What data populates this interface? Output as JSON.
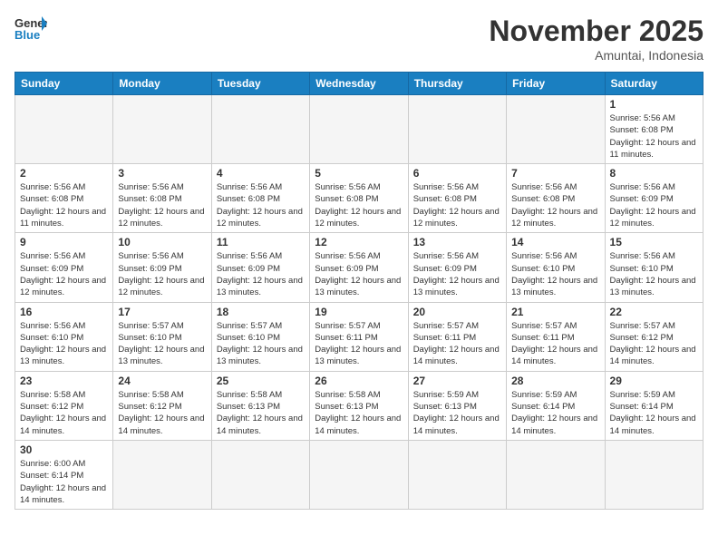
{
  "header": {
    "logo_general": "General",
    "logo_blue": "Blue",
    "month_title": "November 2025",
    "location": "Amuntai, Indonesia"
  },
  "weekdays": [
    "Sunday",
    "Monday",
    "Tuesday",
    "Wednesday",
    "Thursday",
    "Friday",
    "Saturday"
  ],
  "weeks": [
    [
      {
        "day": "",
        "empty": true
      },
      {
        "day": "",
        "empty": true
      },
      {
        "day": "",
        "empty": true
      },
      {
        "day": "",
        "empty": true
      },
      {
        "day": "",
        "empty": true
      },
      {
        "day": "",
        "empty": true
      },
      {
        "day": "1",
        "sunrise": "Sunrise: 5:56 AM",
        "sunset": "Sunset: 6:08 PM",
        "daylight": "Daylight: 12 hours and 11 minutes."
      }
    ],
    [
      {
        "day": "2",
        "sunrise": "Sunrise: 5:56 AM",
        "sunset": "Sunset: 6:08 PM",
        "daylight": "Daylight: 12 hours and 11 minutes."
      },
      {
        "day": "3",
        "sunrise": "Sunrise: 5:56 AM",
        "sunset": "Sunset: 6:08 PM",
        "daylight": "Daylight: 12 hours and 12 minutes."
      },
      {
        "day": "4",
        "sunrise": "Sunrise: 5:56 AM",
        "sunset": "Sunset: 6:08 PM",
        "daylight": "Daylight: 12 hours and 12 minutes."
      },
      {
        "day": "5",
        "sunrise": "Sunrise: 5:56 AM",
        "sunset": "Sunset: 6:08 PM",
        "daylight": "Daylight: 12 hours and 12 minutes."
      },
      {
        "day": "6",
        "sunrise": "Sunrise: 5:56 AM",
        "sunset": "Sunset: 6:08 PM",
        "daylight": "Daylight: 12 hours and 12 minutes."
      },
      {
        "day": "7",
        "sunrise": "Sunrise: 5:56 AM",
        "sunset": "Sunset: 6:08 PM",
        "daylight": "Daylight: 12 hours and 12 minutes."
      },
      {
        "day": "8",
        "sunrise": "Sunrise: 5:56 AM",
        "sunset": "Sunset: 6:09 PM",
        "daylight": "Daylight: 12 hours and 12 minutes."
      }
    ],
    [
      {
        "day": "9",
        "sunrise": "Sunrise: 5:56 AM",
        "sunset": "Sunset: 6:09 PM",
        "daylight": "Daylight: 12 hours and 12 minutes."
      },
      {
        "day": "10",
        "sunrise": "Sunrise: 5:56 AM",
        "sunset": "Sunset: 6:09 PM",
        "daylight": "Daylight: 12 hours and 12 minutes."
      },
      {
        "day": "11",
        "sunrise": "Sunrise: 5:56 AM",
        "sunset": "Sunset: 6:09 PM",
        "daylight": "Daylight: 12 hours and 13 minutes."
      },
      {
        "day": "12",
        "sunrise": "Sunrise: 5:56 AM",
        "sunset": "Sunset: 6:09 PM",
        "daylight": "Daylight: 12 hours and 13 minutes."
      },
      {
        "day": "13",
        "sunrise": "Sunrise: 5:56 AM",
        "sunset": "Sunset: 6:09 PM",
        "daylight": "Daylight: 12 hours and 13 minutes."
      },
      {
        "day": "14",
        "sunrise": "Sunrise: 5:56 AM",
        "sunset": "Sunset: 6:10 PM",
        "daylight": "Daylight: 12 hours and 13 minutes."
      },
      {
        "day": "15",
        "sunrise": "Sunrise: 5:56 AM",
        "sunset": "Sunset: 6:10 PM",
        "daylight": "Daylight: 12 hours and 13 minutes."
      }
    ],
    [
      {
        "day": "16",
        "sunrise": "Sunrise: 5:56 AM",
        "sunset": "Sunset: 6:10 PM",
        "daylight": "Daylight: 12 hours and 13 minutes."
      },
      {
        "day": "17",
        "sunrise": "Sunrise: 5:57 AM",
        "sunset": "Sunset: 6:10 PM",
        "daylight": "Daylight: 12 hours and 13 minutes."
      },
      {
        "day": "18",
        "sunrise": "Sunrise: 5:57 AM",
        "sunset": "Sunset: 6:10 PM",
        "daylight": "Daylight: 12 hours and 13 minutes."
      },
      {
        "day": "19",
        "sunrise": "Sunrise: 5:57 AM",
        "sunset": "Sunset: 6:11 PM",
        "daylight": "Daylight: 12 hours and 13 minutes."
      },
      {
        "day": "20",
        "sunrise": "Sunrise: 5:57 AM",
        "sunset": "Sunset: 6:11 PM",
        "daylight": "Daylight: 12 hours and 14 minutes."
      },
      {
        "day": "21",
        "sunrise": "Sunrise: 5:57 AM",
        "sunset": "Sunset: 6:11 PM",
        "daylight": "Daylight: 12 hours and 14 minutes."
      },
      {
        "day": "22",
        "sunrise": "Sunrise: 5:57 AM",
        "sunset": "Sunset: 6:12 PM",
        "daylight": "Daylight: 12 hours and 14 minutes."
      }
    ],
    [
      {
        "day": "23",
        "sunrise": "Sunrise: 5:58 AM",
        "sunset": "Sunset: 6:12 PM",
        "daylight": "Daylight: 12 hours and 14 minutes."
      },
      {
        "day": "24",
        "sunrise": "Sunrise: 5:58 AM",
        "sunset": "Sunset: 6:12 PM",
        "daylight": "Daylight: 12 hours and 14 minutes."
      },
      {
        "day": "25",
        "sunrise": "Sunrise: 5:58 AM",
        "sunset": "Sunset: 6:13 PM",
        "daylight": "Daylight: 12 hours and 14 minutes."
      },
      {
        "day": "26",
        "sunrise": "Sunrise: 5:58 AM",
        "sunset": "Sunset: 6:13 PM",
        "daylight": "Daylight: 12 hours and 14 minutes."
      },
      {
        "day": "27",
        "sunrise": "Sunrise: 5:59 AM",
        "sunset": "Sunset: 6:13 PM",
        "daylight": "Daylight: 12 hours and 14 minutes."
      },
      {
        "day": "28",
        "sunrise": "Sunrise: 5:59 AM",
        "sunset": "Sunset: 6:14 PM",
        "daylight": "Daylight: 12 hours and 14 minutes."
      },
      {
        "day": "29",
        "sunrise": "Sunrise: 5:59 AM",
        "sunset": "Sunset: 6:14 PM",
        "daylight": "Daylight: 12 hours and 14 minutes."
      }
    ],
    [
      {
        "day": "30",
        "sunrise": "Sunrise: 6:00 AM",
        "sunset": "Sunset: 6:14 PM",
        "daylight": "Daylight: 12 hours and 14 minutes."
      },
      {
        "day": "",
        "empty": true
      },
      {
        "day": "",
        "empty": true
      },
      {
        "day": "",
        "empty": true
      },
      {
        "day": "",
        "empty": true
      },
      {
        "day": "",
        "empty": true
      },
      {
        "day": "",
        "empty": true
      }
    ]
  ]
}
